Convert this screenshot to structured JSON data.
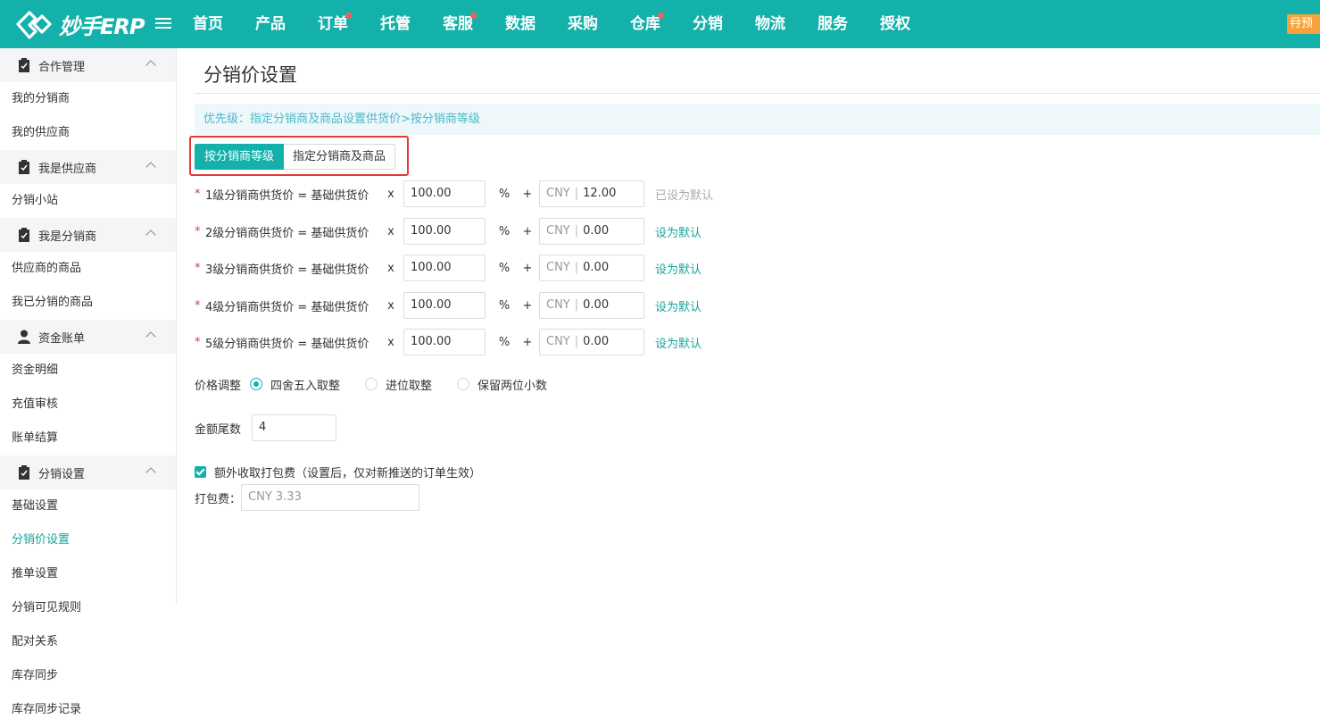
{
  "app": {
    "logo_text": "妙手ERP",
    "preview_badge": "预"
  },
  "nav": [
    "首页",
    "产品",
    "订单",
    "托管",
    "客服",
    "数据",
    "采购",
    "仓库",
    "分销",
    "物流",
    "服务",
    "授权"
  ],
  "sidebar": {
    "groups": [
      {
        "title": "合作管理",
        "icon": "clipboard-icon",
        "items": [
          "我的分销商",
          "我的供应商"
        ]
      },
      {
        "title": "我是供应商",
        "icon": "clipboard-icon",
        "items": [
          "分销小站"
        ]
      },
      {
        "title": "我是分销商",
        "icon": "clipboard-icon",
        "items": [
          "供应商的商品",
          "我已分销的商品"
        ]
      },
      {
        "title": "资金账单",
        "icon": "user-icon",
        "items": [
          "资金明细",
          "充值审核",
          "账单结算"
        ]
      },
      {
        "title": "分销设置",
        "icon": "clipboard-icon",
        "items": [
          "基础设置",
          "分销价设置",
          "推单设置",
          "分销可见规则",
          "配对关系",
          "库存同步",
          "库存同步记录"
        ]
      }
    ]
  },
  "page": {
    "title": "分销价设置",
    "priority_text": "优先级：指定分销商及商品设置供货价>按分销商等级",
    "tabs": {
      "active": "按分销商等级",
      "other": "指定分销商及商品"
    },
    "levels": [
      {
        "formula": "1级分销商供货价 = 基础供货价",
        "factor": "100.00",
        "cny": "12.00",
        "default_label": "已设为默认"
      },
      {
        "formula": "2级分销商供货价 = 基础供货价",
        "factor": "100.00",
        "cny": "0.00",
        "default_label": "设为默认"
      },
      {
        "formula": "3级分销商供货价 = 基础供货价",
        "factor": "100.00",
        "cny": "0.00",
        "default_label": "设为默认"
      },
      {
        "formula": "4级分销商供货价 = 基础供货价",
        "factor": "100.00",
        "cny": "0.00",
        "default_label": "设为默认"
      },
      {
        "formula": "5级分销商供货价 = 基础供货价",
        "factor": "100.00",
        "cny": "0.00",
        "default_label": "设为默认"
      }
    ],
    "symbols": {
      "req": "*",
      "times": "x",
      "percent": "%",
      "plus": "+",
      "currency": "CNY",
      "sep": "|"
    },
    "rounding": {
      "label": "价格调整",
      "options": [
        "四舍五入取整",
        "进位取整",
        "保留两位小数"
      ]
    },
    "tail": {
      "label": "金额尾数",
      "value": "4"
    },
    "packing": {
      "checkbox_label": "额外收取打包费（设置后，仅对新推送的订单生效）",
      "fee_label": "打包费：",
      "fee_value": "CNY  3.33"
    }
  },
  "colors": {
    "brand": "#14b1ab",
    "highlight": "#e53935",
    "badge": "#f7a23a"
  }
}
